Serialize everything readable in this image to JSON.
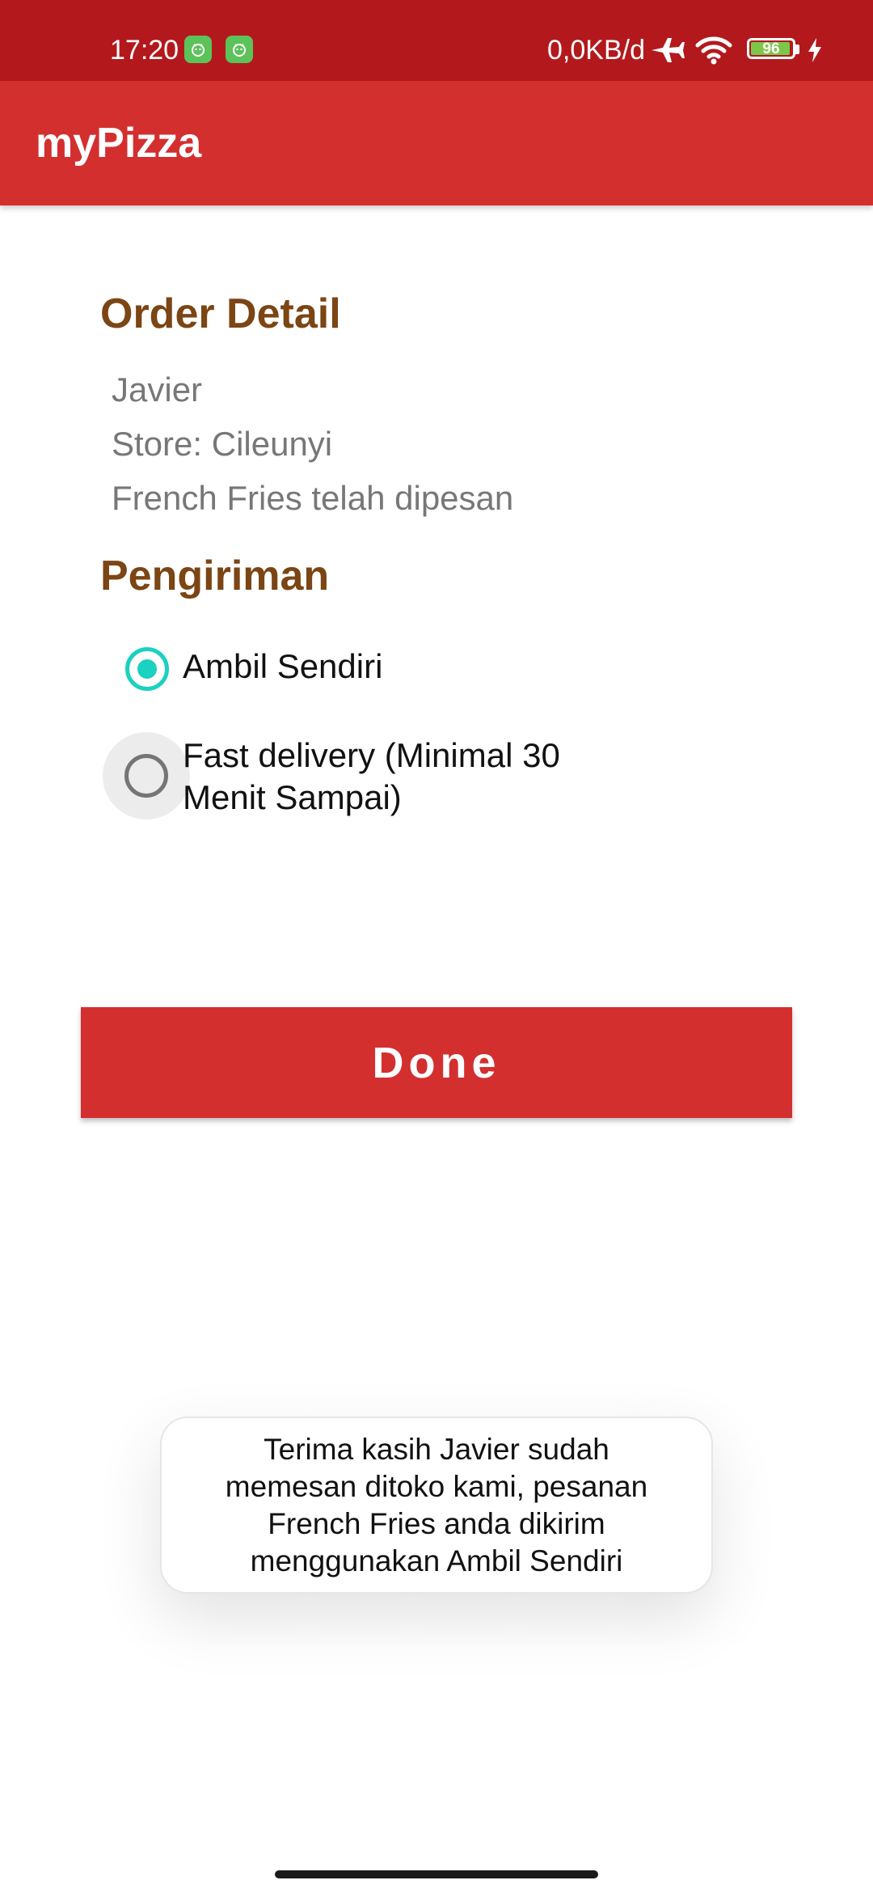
{
  "status_bar": {
    "time": "17:20",
    "net_speed": "0,0KB/d",
    "battery_level": "96",
    "battery_fraction": 0.96,
    "icons": [
      "android-app-icon",
      "android-app-icon",
      "airplane-mode-icon",
      "wifi-icon",
      "battery-icon",
      "charging-bolt-icon"
    ]
  },
  "app_bar": {
    "title": "myPizza"
  },
  "order_detail": {
    "heading": "Order Detail",
    "customer_name": "Javier",
    "store_label": "Store:",
    "store_name": "Cileunyi",
    "order_text": "French Fries telah dipesan"
  },
  "delivery": {
    "heading": "Pengiriman",
    "options": [
      {
        "label": "Ambil Sendiri",
        "selected": true
      },
      {
        "label_line1": "Fast delivery (Minimal 30",
        "label_line2": "Menit Sampai)",
        "selected": false
      }
    ]
  },
  "done_button": {
    "label": "Done"
  },
  "toast": {
    "line1": "Terima kasih Javier sudah",
    "line2": "memesan ditoko kami, pesanan",
    "line3": "French Fries anda dikirim",
    "line4": "menggunakan Ambil Sendiri"
  },
  "colors": {
    "status_bar": "#b3191c",
    "app_bar": "#d32f2f",
    "heading": "#7b4514",
    "radio_selected": "#1bd1c0"
  }
}
